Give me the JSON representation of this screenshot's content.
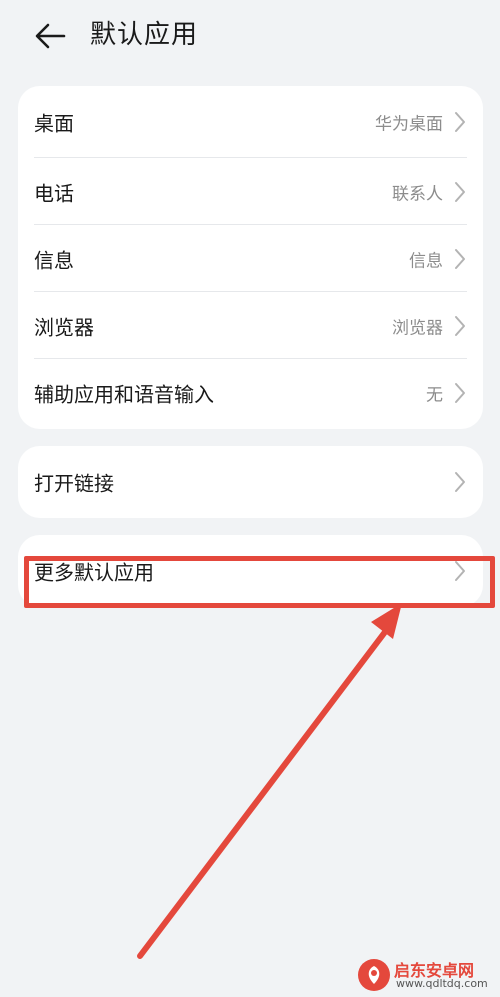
{
  "header": {
    "title": "默认应用",
    "back_icon": "arrow-left-icon"
  },
  "default_apps": [
    {
      "label": "桌面",
      "value": "华为桌面"
    },
    {
      "label": "电话",
      "value": "联系人"
    },
    {
      "label": "信息",
      "value": "信息"
    },
    {
      "label": "浏览器",
      "value": "浏览器"
    },
    {
      "label": "辅助应用和语音输入",
      "value": "无"
    }
  ],
  "open_links": {
    "label": "打开链接"
  },
  "more_default_apps": {
    "label": "更多默认应用"
  },
  "annotation": {
    "color": "#e4483c"
  },
  "watermark": {
    "name": "启东安卓网",
    "url": "www.qdltdq.com"
  },
  "colors": {
    "background": "#f1f3f5",
    "card": "#ffffff",
    "value_text": "#8c8c8c",
    "chevron": "#b3b3b3"
  }
}
